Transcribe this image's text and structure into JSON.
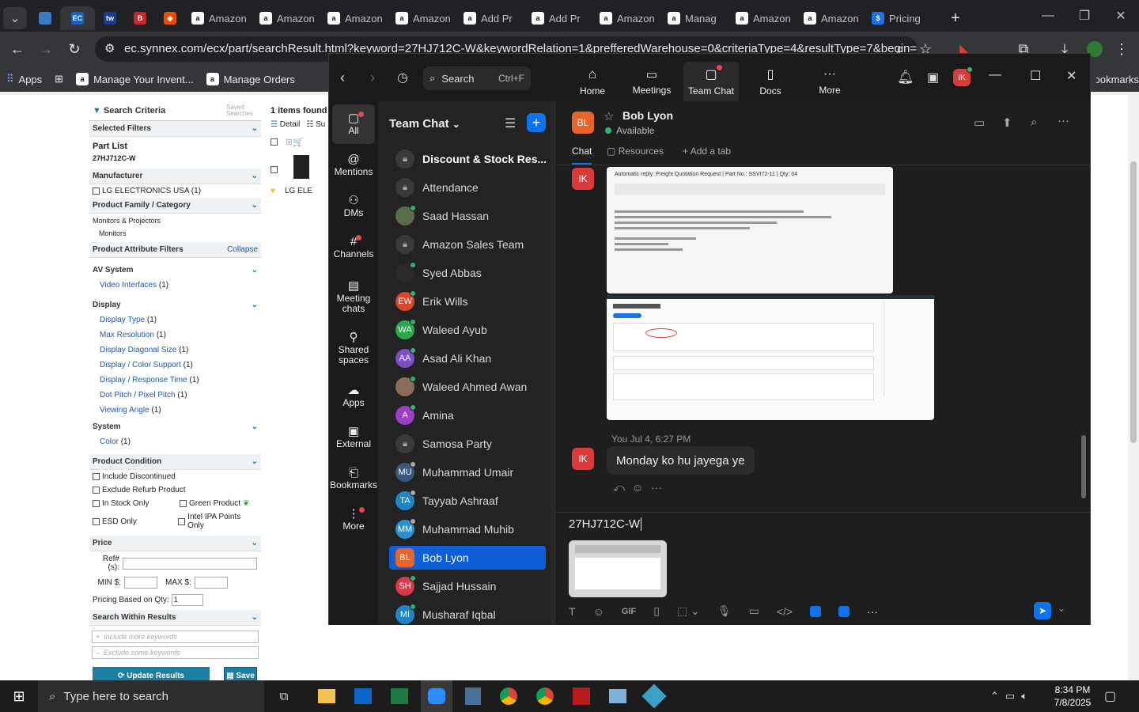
{
  "browser": {
    "tabs": [
      {
        "label": "",
        "icon": "dropdown-icon"
      },
      {
        "label": "",
        "icon": "edge-icon"
      },
      {
        "label": "",
        "icon": "ec-icon",
        "active": true
      },
      {
        "label": "",
        "icon": "tab-icon-blue"
      },
      {
        "label": "",
        "icon": "tab-icon-red"
      },
      {
        "label": "",
        "icon": "tab-icon-orange"
      },
      {
        "label": "Amazon",
        "icon": "amazon-icon"
      },
      {
        "label": "Amazon",
        "icon": "amazon-icon"
      },
      {
        "label": "Amazon",
        "icon": "amazon-icon"
      },
      {
        "label": "Amazon",
        "icon": "amazon-icon"
      },
      {
        "label": "Add Pr",
        "icon": "amazon-icon"
      },
      {
        "label": "Add Pr",
        "icon": "amazon-icon"
      },
      {
        "label": "Amazon",
        "icon": "amazon-icon"
      },
      {
        "label": "Manag",
        "icon": "amazon-icon"
      },
      {
        "label": "Amazon",
        "icon": "amazon-icon"
      },
      {
        "label": "Amazon",
        "icon": "amazon-icon"
      },
      {
        "label": "Pricing",
        "icon": "dollar-icon"
      }
    ],
    "url": "ec.synnex.com/ecx/part/searchResult.html?keyword=27HJ712C-W&keywordRelation=1&prefferedWarehouse=0&criteriaType=4&resultType=7&begin=0...",
    "bookmarks": [
      "Apps",
      "",
      "Manage Your Invent...",
      "Manage Orders"
    ],
    "bookmarks_right": "Bookmarks"
  },
  "synnex": {
    "search_criteria": "Search Criteria",
    "saved_searches": "Saved Searches",
    "selected_filters": "Selected Filters",
    "part_list_label": "Part List",
    "part_list_value": "27HJ712C-W",
    "manufacturer": "Manufacturer",
    "manufacturer_option": "LG ELECTRONICS USA (1)",
    "product_family": "Product Family / Category",
    "product_family_1": "Monitors & Projectors",
    "product_family_2": "Monitors",
    "attribute_filters": "Product Attribute Filters",
    "collapse": "Collapse",
    "av_system": "AV System",
    "video_interfaces": "Video Interfaces",
    "display": "Display",
    "display_links": [
      "Display Type",
      "Max Resolution",
      "Display Diagonal Size",
      "Display / Color Support",
      "Display / Response Time",
      "Dot Pitch / Pixel Pitch",
      "Viewing Angle"
    ],
    "count_1": "(1)",
    "system": "System",
    "color": "Color",
    "product_condition": "Product Condition",
    "include_discontinued": "Include Discontinued",
    "exclude_refurb": "Exclude Refurb Product",
    "in_stock_only": "In Stock Only",
    "green_product": "Green Product",
    "esd_only": "ESD Only",
    "intel_ipa": "Intel IPA Points Only",
    "price": "Price",
    "ref_label": "Ref#(s):",
    "min_label": "MIN $:",
    "max_label": "MAX $:",
    "pricing_qty_label": "Pricing Based on Qty:",
    "pricing_qty_value": "1",
    "search_within": "Search Within Results",
    "include_kw": "Include more keywords",
    "exclude_kw": "Exclude some keywords",
    "update_results": "Update Results",
    "save": "Save",
    "items_found": "1 items found",
    "detail": "Detail",
    "su": "Su",
    "lg_label": "LG ELE"
  },
  "zoom": {
    "search_label": "Search",
    "search_shortcut": "Ctrl+F",
    "tabs": [
      "Home",
      "Meetings",
      "Team Chat",
      "Docs",
      "More"
    ],
    "avatar_initials": "IK",
    "rail": [
      "All",
      "Mentions",
      "DMs",
      "Channels",
      "Meeting chats",
      "Shared spaces",
      "Apps",
      "External",
      "Bookmarks",
      "More"
    ],
    "list_title": "Team Chat",
    "channels": [
      {
        "name": "Discount & Stock Res...",
        "type": "lock",
        "bold": true
      },
      {
        "name": "Attendance",
        "type": "lock"
      },
      {
        "name": "Saad Hassan",
        "type": "photo",
        "color": "#5a6b4a"
      },
      {
        "name": "Amazon Sales Team",
        "type": "lock"
      },
      {
        "name": "Syed Abbas",
        "type": "photo",
        "color": "#2a2a2a"
      },
      {
        "name": "Erik Wills",
        "type": "initials",
        "initials": "EW",
        "color": "#d9472b"
      },
      {
        "name": "Waleed Ayub",
        "type": "initials",
        "initials": "WA",
        "color": "#2ba84a"
      },
      {
        "name": "Asad Ali Khan",
        "type": "initials",
        "initials": "AA",
        "color": "#7b4fc4"
      },
      {
        "name": "Waleed Ahmed Awan",
        "type": "photo",
        "color": "#8a6a5a"
      },
      {
        "name": "Amina",
        "type": "initials",
        "initials": "A",
        "color": "#9b3fc4"
      },
      {
        "name": "Samosa Party",
        "type": "lock"
      },
      {
        "name": "Muhammad Umair",
        "type": "initials",
        "initials": "MU",
        "color": "#3b5a7a",
        "away": true
      },
      {
        "name": "Tayyab Ashraaf",
        "type": "initials",
        "initials": "TA",
        "color": "#1e86c8",
        "away": true
      },
      {
        "name": "Muhammad Muhib",
        "type": "initials",
        "initials": "MM",
        "color": "#2b8fd1",
        "away": true
      },
      {
        "name": "Bob Lyon",
        "type": "initials",
        "initials": "BL",
        "color": "#e8642a",
        "selected": true
      },
      {
        "name": "Sajjad Hussain",
        "type": "initials",
        "initials": "SH",
        "color": "#d93a4a"
      },
      {
        "name": "Musharaf Iqbal",
        "type": "initials",
        "initials": "MI",
        "color": "#1e86c8"
      }
    ],
    "contact": {
      "initials": "BL",
      "name": "Bob Lyon",
      "status": "Available"
    },
    "chat_tabs": {
      "chat": "Chat",
      "resources": "Resources",
      "add_tab": "Add a tab"
    },
    "email_preview_title": "Automatic reply: Freight Quotation Request | Part No.: SSVI72-11 | Qty: 04",
    "message": {
      "sender": "You",
      "time": "Jul 4, 6:27 PM",
      "text": "Monday ko hu jayega ye",
      "initials": "IK"
    },
    "compose_text": "27HJ712C-W",
    "gif_label": "GIF"
  },
  "taskbar": {
    "search_placeholder": "Type here to search",
    "time": "8:34 PM",
    "date": "7/8/2025"
  },
  "colors": {
    "zoom_blue": "#0e72ed",
    "selected": "#0e5ed7",
    "accent_teal": "#1b7fa1"
  }
}
